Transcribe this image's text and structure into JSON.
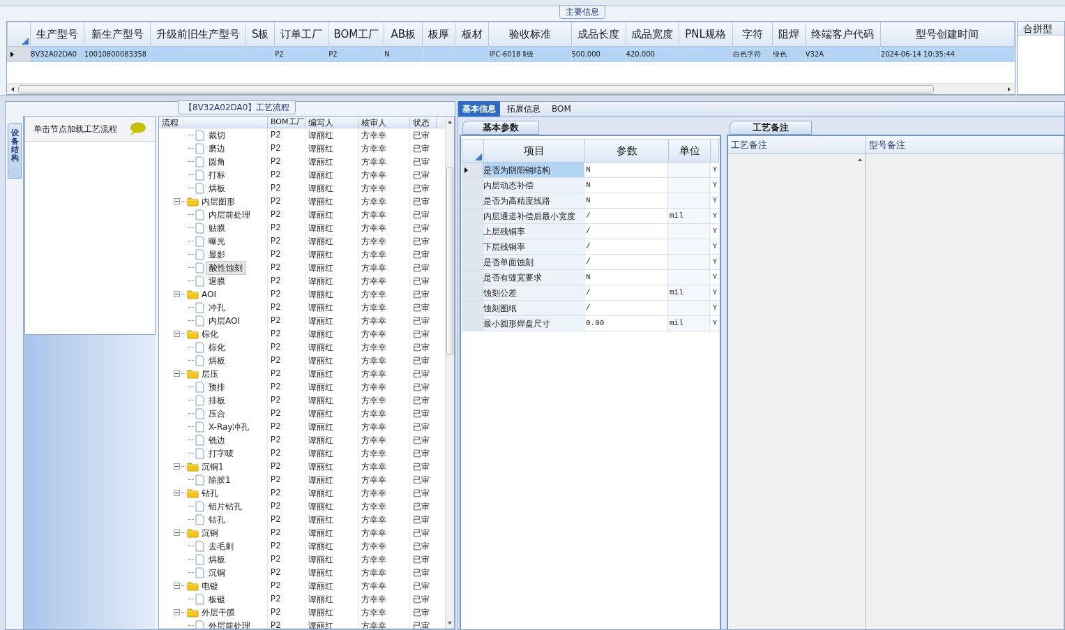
{
  "main_info": {
    "title": "主要信息",
    "columns": [
      "生产型号",
      "新生产型号",
      "升级前旧生产型号",
      "S板",
      "订单工厂",
      "BOM工厂",
      "AB板",
      "板厚",
      "板材",
      "验收标准",
      "成品长度",
      "成品宽度",
      "PNL规格",
      "字符",
      "阻焊",
      "终端客户代码",
      "型号创建时间"
    ],
    "rows": [
      {
        "selected": true,
        "cells": [
          "8V32A02DA0",
          "10010800083358",
          null,
          null,
          "P2",
          "P2",
          "N",
          null,
          null,
          "IPC-6018 Ⅱ级",
          "500.000",
          "420.000",
          null,
          "白色字符",
          "绿色",
          "V32A",
          "2024-06-14 10:35:44"
        ]
      }
    ],
    "side_panel": {
      "title": "合拼型"
    }
  },
  "process": {
    "title": "【8V32A02DA0】工艺流程",
    "side_tab": "设备结构",
    "hint": "单击节点加载工艺流程",
    "columns": [
      "流程",
      "BOM工厂",
      "编写人",
      "核审人",
      "状态"
    ],
    "tree": [
      {
        "label": "裁切",
        "selected": false,
        "bom": "P2",
        "writer": "谭丽红",
        "reviewer": "方幸幸",
        "status": "已审"
      },
      {
        "label": "磨边",
        "selected": false,
        "bom": "P2",
        "writer": "谭丽红",
        "reviewer": "方幸幸",
        "status": "已审"
      },
      {
        "label": "圆角",
        "selected": false,
        "bom": "P2",
        "writer": "谭丽红",
        "reviewer": "方幸幸",
        "status": "已审"
      },
      {
        "label": "打标",
        "selected": false,
        "bom": "P2",
        "writer": "谭丽红",
        "reviewer": "方幸幸",
        "status": "已审"
      },
      {
        "label": "烘板",
        "selected": false,
        "bom": "P2",
        "writer": "谭丽红",
        "reviewer": "方幸幸",
        "status": "已审"
      },
      {
        "label": "内层图形",
        "selected": false,
        "expanded": true,
        "bom": "P2",
        "writer": "谭丽红",
        "reviewer": "方幸幸",
        "status": "已审",
        "children": [
          {
            "label": "内层前处理",
            "selected": false,
            "bom": "P2",
            "writer": "谭丽红",
            "reviewer": "方幸幸",
            "status": "已审"
          },
          {
            "label": "贴膜",
            "selected": false,
            "bom": "P2",
            "writer": "谭丽红",
            "reviewer": "方幸幸",
            "status": "已审"
          },
          {
            "label": "曝光",
            "selected": false,
            "bom": "P2",
            "writer": "谭丽红",
            "reviewer": "方幸幸",
            "status": "已审"
          },
          {
            "label": "显影",
            "selected": false,
            "bom": "P2",
            "writer": "谭丽红",
            "reviewer": "方幸幸",
            "status": "已审"
          },
          {
            "label": "酸性蚀刻",
            "selected": true,
            "bom": "P2",
            "writer": "谭丽红",
            "reviewer": "方幸幸",
            "status": "已审"
          },
          {
            "label": "退膜",
            "selected": false,
            "bom": "P2",
            "writer": "谭丽红",
            "reviewer": "方幸幸",
            "status": "已审"
          }
        ]
      },
      {
        "label": "AOI",
        "selected": false,
        "expanded": true,
        "bom": "P2",
        "writer": "谭丽红",
        "reviewer": "方幸幸",
        "status": "已审",
        "children": [
          {
            "label": "冲孔",
            "selected": false,
            "bom": "P2",
            "writer": "谭丽红",
            "reviewer": "方幸幸",
            "status": "已审"
          },
          {
            "label": "内层AOI",
            "selected": false,
            "bom": "P2",
            "writer": "谭丽红",
            "reviewer": "方幸幸",
            "status": "已审"
          }
        ]
      },
      {
        "label": "棕化",
        "selected": false,
        "expanded": true,
        "bom": "P2",
        "writer": "谭丽红",
        "reviewer": "方幸幸",
        "status": "已审",
        "children": [
          {
            "label": "棕化",
            "selected": false,
            "bom": "P2",
            "writer": "谭丽红",
            "reviewer": "方幸幸",
            "status": "已审"
          },
          {
            "label": "烘板",
            "selected": false,
            "bom": "P2",
            "writer": "谭丽红",
            "reviewer": "方幸幸",
            "status": "已审"
          }
        ]
      },
      {
        "label": "层压",
        "selected": false,
        "expanded": true,
        "bom": "P2",
        "writer": "谭丽红",
        "reviewer": "方幸幸",
        "status": "已审",
        "children": [
          {
            "label": "预排",
            "selected": false,
            "bom": "P2",
            "writer": "谭丽红",
            "reviewer": "方幸幸",
            "status": "已审"
          },
          {
            "label": "排板",
            "selected": false,
            "bom": "P2",
            "writer": "谭丽红",
            "reviewer": "方幸幸",
            "status": "已审"
          },
          {
            "label": "压合",
            "selected": false,
            "bom": "P2",
            "writer": "谭丽红",
            "reviewer": "方幸幸",
            "status": "已审"
          },
          {
            "label": "X-Ray冲孔",
            "selected": false,
            "bom": "P2",
            "writer": "谭丽红",
            "reviewer": "方幸幸",
            "status": "已审"
          },
          {
            "label": "铣边",
            "selected": false,
            "bom": "P2",
            "writer": "谭丽红",
            "reviewer": "方幸幸",
            "status": "已审"
          },
          {
            "label": "打字唛",
            "selected": false,
            "bom": "P2",
            "writer": "谭丽红",
            "reviewer": "方幸幸",
            "status": "已审"
          }
        ]
      },
      {
        "label": "沉铜1",
        "selected": false,
        "expanded": true,
        "bom": "P2",
        "writer": "谭丽红",
        "reviewer": "方幸幸",
        "status": "已审",
        "children": [
          {
            "label": "除胶1",
            "selected": false,
            "bom": "P2",
            "writer": "谭丽红",
            "reviewer": "方幸幸",
            "status": "已审"
          }
        ]
      },
      {
        "label": "钻孔",
        "selected": false,
        "expanded": true,
        "bom": "P2",
        "writer": "谭丽红",
        "reviewer": "方幸幸",
        "status": "已审",
        "children": [
          {
            "label": "铝片钻孔",
            "selected": false,
            "bom": "P2",
            "writer": "谭丽红",
            "reviewer": "方幸幸",
            "status": "已审"
          },
          {
            "label": "钻孔",
            "selected": false,
            "bom": "P2",
            "writer": "谭丽红",
            "reviewer": "方幸幸",
            "status": "已审"
          }
        ]
      },
      {
        "label": "沉铜",
        "selected": false,
        "expanded": true,
        "bom": "P2",
        "writer": "谭丽红",
        "reviewer": "方幸幸",
        "status": "已审",
        "children": [
          {
            "label": "去毛刺",
            "selected": false,
            "bom": "P2",
            "writer": "谭丽红",
            "reviewer": "方幸幸",
            "status": "已审"
          },
          {
            "label": "烘板",
            "selected": false,
            "bom": "P2",
            "writer": "谭丽红",
            "reviewer": "方幸幸",
            "status": "已审"
          },
          {
            "label": "沉铜",
            "selected": false,
            "bom": "P2",
            "writer": "谭丽红",
            "reviewer": "方幸幸",
            "status": "已审"
          }
        ]
      },
      {
        "label": "电镀",
        "selected": false,
        "expanded": true,
        "bom": "P2",
        "writer": "谭丽红",
        "reviewer": "方幸幸",
        "status": "已审",
        "children": [
          {
            "label": "板镀",
            "selected": false,
            "bom": "P2",
            "writer": "谭丽红",
            "reviewer": "方幸幸",
            "status": "已审"
          }
        ]
      },
      {
        "label": "外层干膜",
        "selected": false,
        "expanded": true,
        "bom": "P2",
        "writer": "谭丽红",
        "reviewer": "方幸幸",
        "status": "已审",
        "children": [
          {
            "label": "外层前处理",
            "selected": false,
            "bom": "P2",
            "writer": "谭丽红",
            "reviewer": "方幸幸",
            "status": "已审"
          }
        ]
      }
    ]
  },
  "detail_tabs": [
    {
      "label": "基本信息",
      "selected": true
    },
    {
      "label": "拓展信息",
      "selected": false
    },
    {
      "label": "BOM",
      "selected": false
    }
  ],
  "basic_params": {
    "title": "基本参数",
    "columns": [
      "项目",
      "参数",
      "单位"
    ],
    "rows": [
      {
        "item": "是否为阴阳铜结构",
        "value": "N",
        "flag": "Y",
        "selected": true
      },
      {
        "item": "内层动态补偿",
        "value": "N",
        "flag": "Y",
        "selected": false
      },
      {
        "item": "是否为高精度线路",
        "value": "N",
        "flag": "Y",
        "selected": false
      },
      {
        "item": "内层通道补偿后最小宽度",
        "value": "/",
        "unit": "mil",
        "flag": "Y",
        "selected": false
      },
      {
        "item": "上层残铜率",
        "value": "/",
        "flag": "Y",
        "selected": false
      },
      {
        "item": "下层残铜率",
        "value": "/",
        "flag": "Y",
        "selected": false
      },
      {
        "item": "是否单面蚀刻",
        "value": "/",
        "flag": "Y",
        "selected": false
      },
      {
        "item": "是否有缝宽要求",
        "value": "N",
        "flag": "Y",
        "selected": false
      },
      {
        "item": "蚀刻公差",
        "value": "/",
        "unit": "mil",
        "flag": "Y",
        "selected": false
      },
      {
        "item": "蚀刻图纸",
        "value": "/",
        "flag": "Y",
        "selected": false
      },
      {
        "item": "最小圆形焊盘尺寸",
        "value": "0.00",
        "unit": "mil",
        "flag": "Y",
        "selected": false
      }
    ]
  },
  "process_notes": {
    "title": "工艺备注",
    "columns": [
      "工艺备注",
      "型号备注"
    ]
  }
}
